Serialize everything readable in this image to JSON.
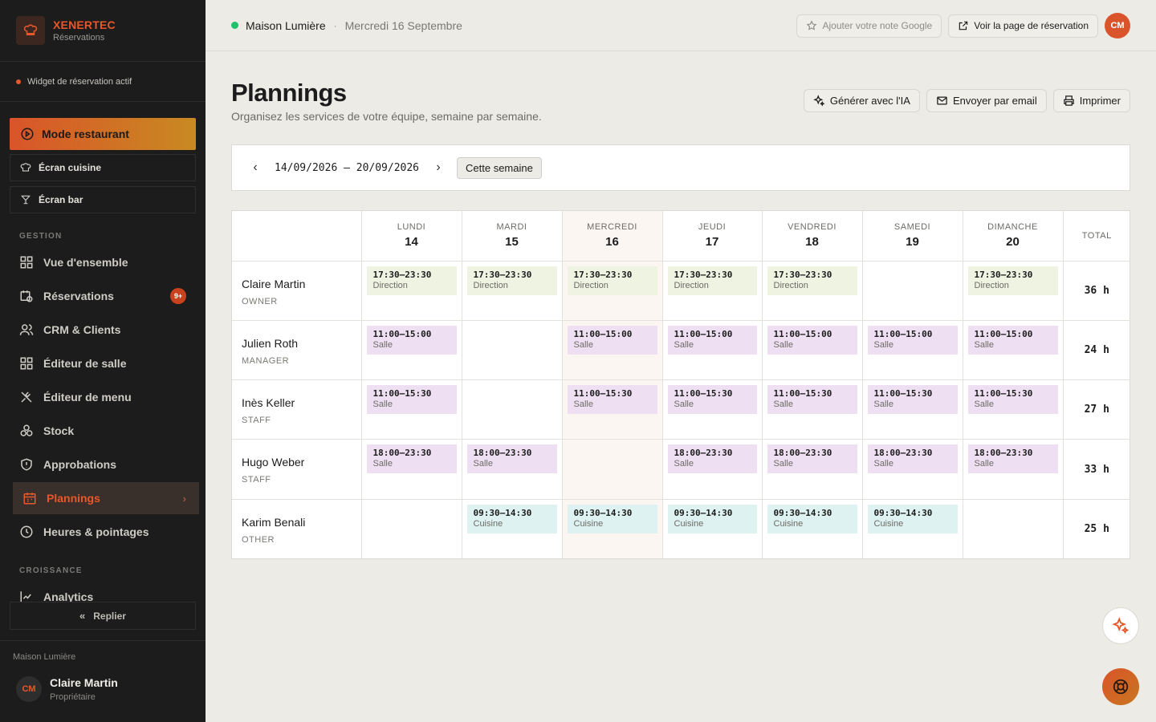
{
  "brand": {
    "name": "XENERTEC",
    "sub": "Réservations"
  },
  "widget_status": "Widget de réservation actif",
  "mode_restaurant": "Mode restaurant",
  "quick": {
    "kitchen": "Écran cuisine",
    "bar": "Écran bar"
  },
  "sections": {
    "gestion": "GESTION",
    "croissance": "CROISSANCE"
  },
  "nav": {
    "overview": "Vue d'ensemble",
    "reservations": "Réservations",
    "reservations_badge": "9+",
    "crm": "CRM & Clients",
    "room_editor": "Éditeur de salle",
    "menu_editor": "Éditeur de menu",
    "stock": "Stock",
    "supplies": "Approbations",
    "plannings": "Plannings",
    "hours": "Heures & pointages",
    "analytics": "Analytics"
  },
  "collapse": "Replier",
  "footer": {
    "place": "Maison Lumière",
    "initials": "CM",
    "name": "Claire Martin",
    "role": "Propriétaire"
  },
  "topbar": {
    "place": "Maison Lumière",
    "separator": "·",
    "date": "Mercredi 16 Septembre",
    "google": "Ajouter votre note Google",
    "booking_page": "Voir la page de réservation",
    "initials": "CM"
  },
  "page": {
    "title": "Plannings",
    "subtitle": "Organisez les services de votre équipe, semaine par semaine.",
    "ai": "Générer avec l'IA",
    "email": "Envoyer par email",
    "print": "Imprimer"
  },
  "week": {
    "range": "14/09/2026 – 20/09/2026",
    "this_week": "Cette semaine"
  },
  "days": [
    {
      "name": "LUNDI",
      "num": "14"
    },
    {
      "name": "MARDI",
      "num": "15"
    },
    {
      "name": "MERCREDI",
      "num": "16"
    },
    {
      "name": "JEUDI",
      "num": "17"
    },
    {
      "name": "VENDREDI",
      "num": "18"
    },
    {
      "name": "SAMEDI",
      "num": "19"
    },
    {
      "name": "DIMANCHE",
      "num": "20"
    }
  ],
  "total_label": "TOTAL",
  "employees": [
    {
      "name": "Claire Martin",
      "role": "OWNER",
      "total": "36 h",
      "shifts": [
        {
          "time": "17:30–23:30",
          "role": "Direction"
        },
        {
          "time": "17:30–23:30",
          "role": "Direction"
        },
        {
          "time": "17:30–23:30",
          "role": "Direction"
        },
        {
          "time": "17:30–23:30",
          "role": "Direction"
        },
        {
          "time": "17:30–23:30",
          "role": "Direction"
        },
        null,
        {
          "time": "17:30–23:30",
          "role": "Direction"
        }
      ]
    },
    {
      "name": "Julien Roth",
      "role": "MANAGER",
      "total": "24 h",
      "shifts": [
        {
          "time": "11:00–15:00",
          "role": "Salle"
        },
        null,
        {
          "time": "11:00–15:00",
          "role": "Salle"
        },
        {
          "time": "11:00–15:00",
          "role": "Salle"
        },
        {
          "time": "11:00–15:00",
          "role": "Salle"
        },
        {
          "time": "11:00–15:00",
          "role": "Salle"
        },
        {
          "time": "11:00–15:00",
          "role": "Salle"
        }
      ]
    },
    {
      "name": "Inès Keller",
      "role": "STAFF",
      "total": "27 h",
      "shifts": [
        {
          "time": "11:00–15:30",
          "role": "Salle"
        },
        null,
        {
          "time": "11:00–15:30",
          "role": "Salle"
        },
        {
          "time": "11:00–15:30",
          "role": "Salle"
        },
        {
          "time": "11:00–15:30",
          "role": "Salle"
        },
        {
          "time": "11:00–15:30",
          "role": "Salle"
        },
        {
          "time": "11:00–15:30",
          "role": "Salle"
        }
      ]
    },
    {
      "name": "Hugo Weber",
      "role": "STAFF",
      "total": "33 h",
      "shifts": [
        {
          "time": "18:00–23:30",
          "role": "Salle"
        },
        {
          "time": "18:00–23:30",
          "role": "Salle"
        },
        null,
        {
          "time": "18:00–23:30",
          "role": "Salle"
        },
        {
          "time": "18:00–23:30",
          "role": "Salle"
        },
        {
          "time": "18:00–23:30",
          "role": "Salle"
        },
        {
          "time": "18:00–23:30",
          "role": "Salle"
        }
      ]
    },
    {
      "name": "Karim Benali",
      "role": "OTHER",
      "total": "25 h",
      "shifts": [
        null,
        {
          "time": "09:30–14:30",
          "role": "Cuisine"
        },
        {
          "time": "09:30–14:30",
          "role": "Cuisine"
        },
        {
          "time": "09:30–14:30",
          "role": "Cuisine"
        },
        {
          "time": "09:30–14:30",
          "role": "Cuisine"
        },
        {
          "time": "09:30–14:30",
          "role": "Cuisine"
        },
        null
      ]
    }
  ],
  "colors": {
    "accent": "#e8572c",
    "direction": "#eef3e2",
    "salle": "#efdff2",
    "cuisine": "#def2f1",
    "online": "#1fc16b"
  }
}
